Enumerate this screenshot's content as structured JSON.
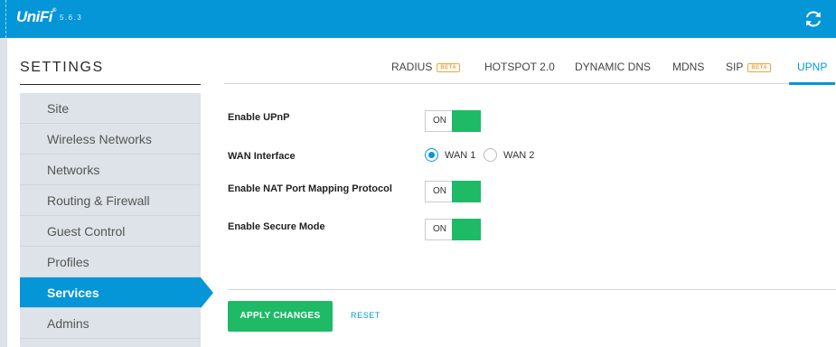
{
  "app": {
    "logo_text": "UniFi",
    "logo_mark": "®",
    "version": "5.6.3"
  },
  "header": {
    "refresh_icon": "refresh-icon"
  },
  "settings": {
    "title": "SETTINGS"
  },
  "sidebar": {
    "items": [
      {
        "label": "Site",
        "active": false
      },
      {
        "label": "Wireless Networks",
        "active": false
      },
      {
        "label": "Networks",
        "active": false
      },
      {
        "label": "Routing & Firewall",
        "active": false
      },
      {
        "label": "Guest Control",
        "active": false
      },
      {
        "label": "Profiles",
        "active": false
      },
      {
        "label": "Services",
        "active": true
      },
      {
        "label": "Admins",
        "active": false
      }
    ]
  },
  "tabs": [
    {
      "label": "RADIUS",
      "badge": "BETA",
      "active": false
    },
    {
      "label": "HOTSPOT 2.0",
      "badge": "",
      "active": false
    },
    {
      "label": "DYNAMIC DNS",
      "badge": "",
      "active": false
    },
    {
      "label": "MDNS",
      "badge": "",
      "active": false
    },
    {
      "label": "SIP",
      "badge": "BETA",
      "active": false
    },
    {
      "label": "UPNP",
      "badge": "",
      "active": true
    }
  ],
  "form": {
    "enable_upnp": {
      "label": "Enable UPnP",
      "state": "ON"
    },
    "wan_interface": {
      "label": "WAN Interface",
      "options": [
        {
          "label": "WAN 1",
          "checked": true
        },
        {
          "label": "WAN 2",
          "checked": false
        }
      ]
    },
    "enable_nat_pmp": {
      "label": "Enable NAT Port Mapping Protocol",
      "state": "ON"
    },
    "enable_secure_mode": {
      "label": "Enable Secure Mode",
      "state": "ON"
    }
  },
  "actions": {
    "apply_label": "APPLY CHANGES",
    "reset_label": "RESET"
  },
  "colors": {
    "brand_blue": "#0596d8",
    "toggle_green": "#1eba66",
    "beta_orange": "#f0a43c",
    "sidebar_bg": "#dde3e8"
  }
}
